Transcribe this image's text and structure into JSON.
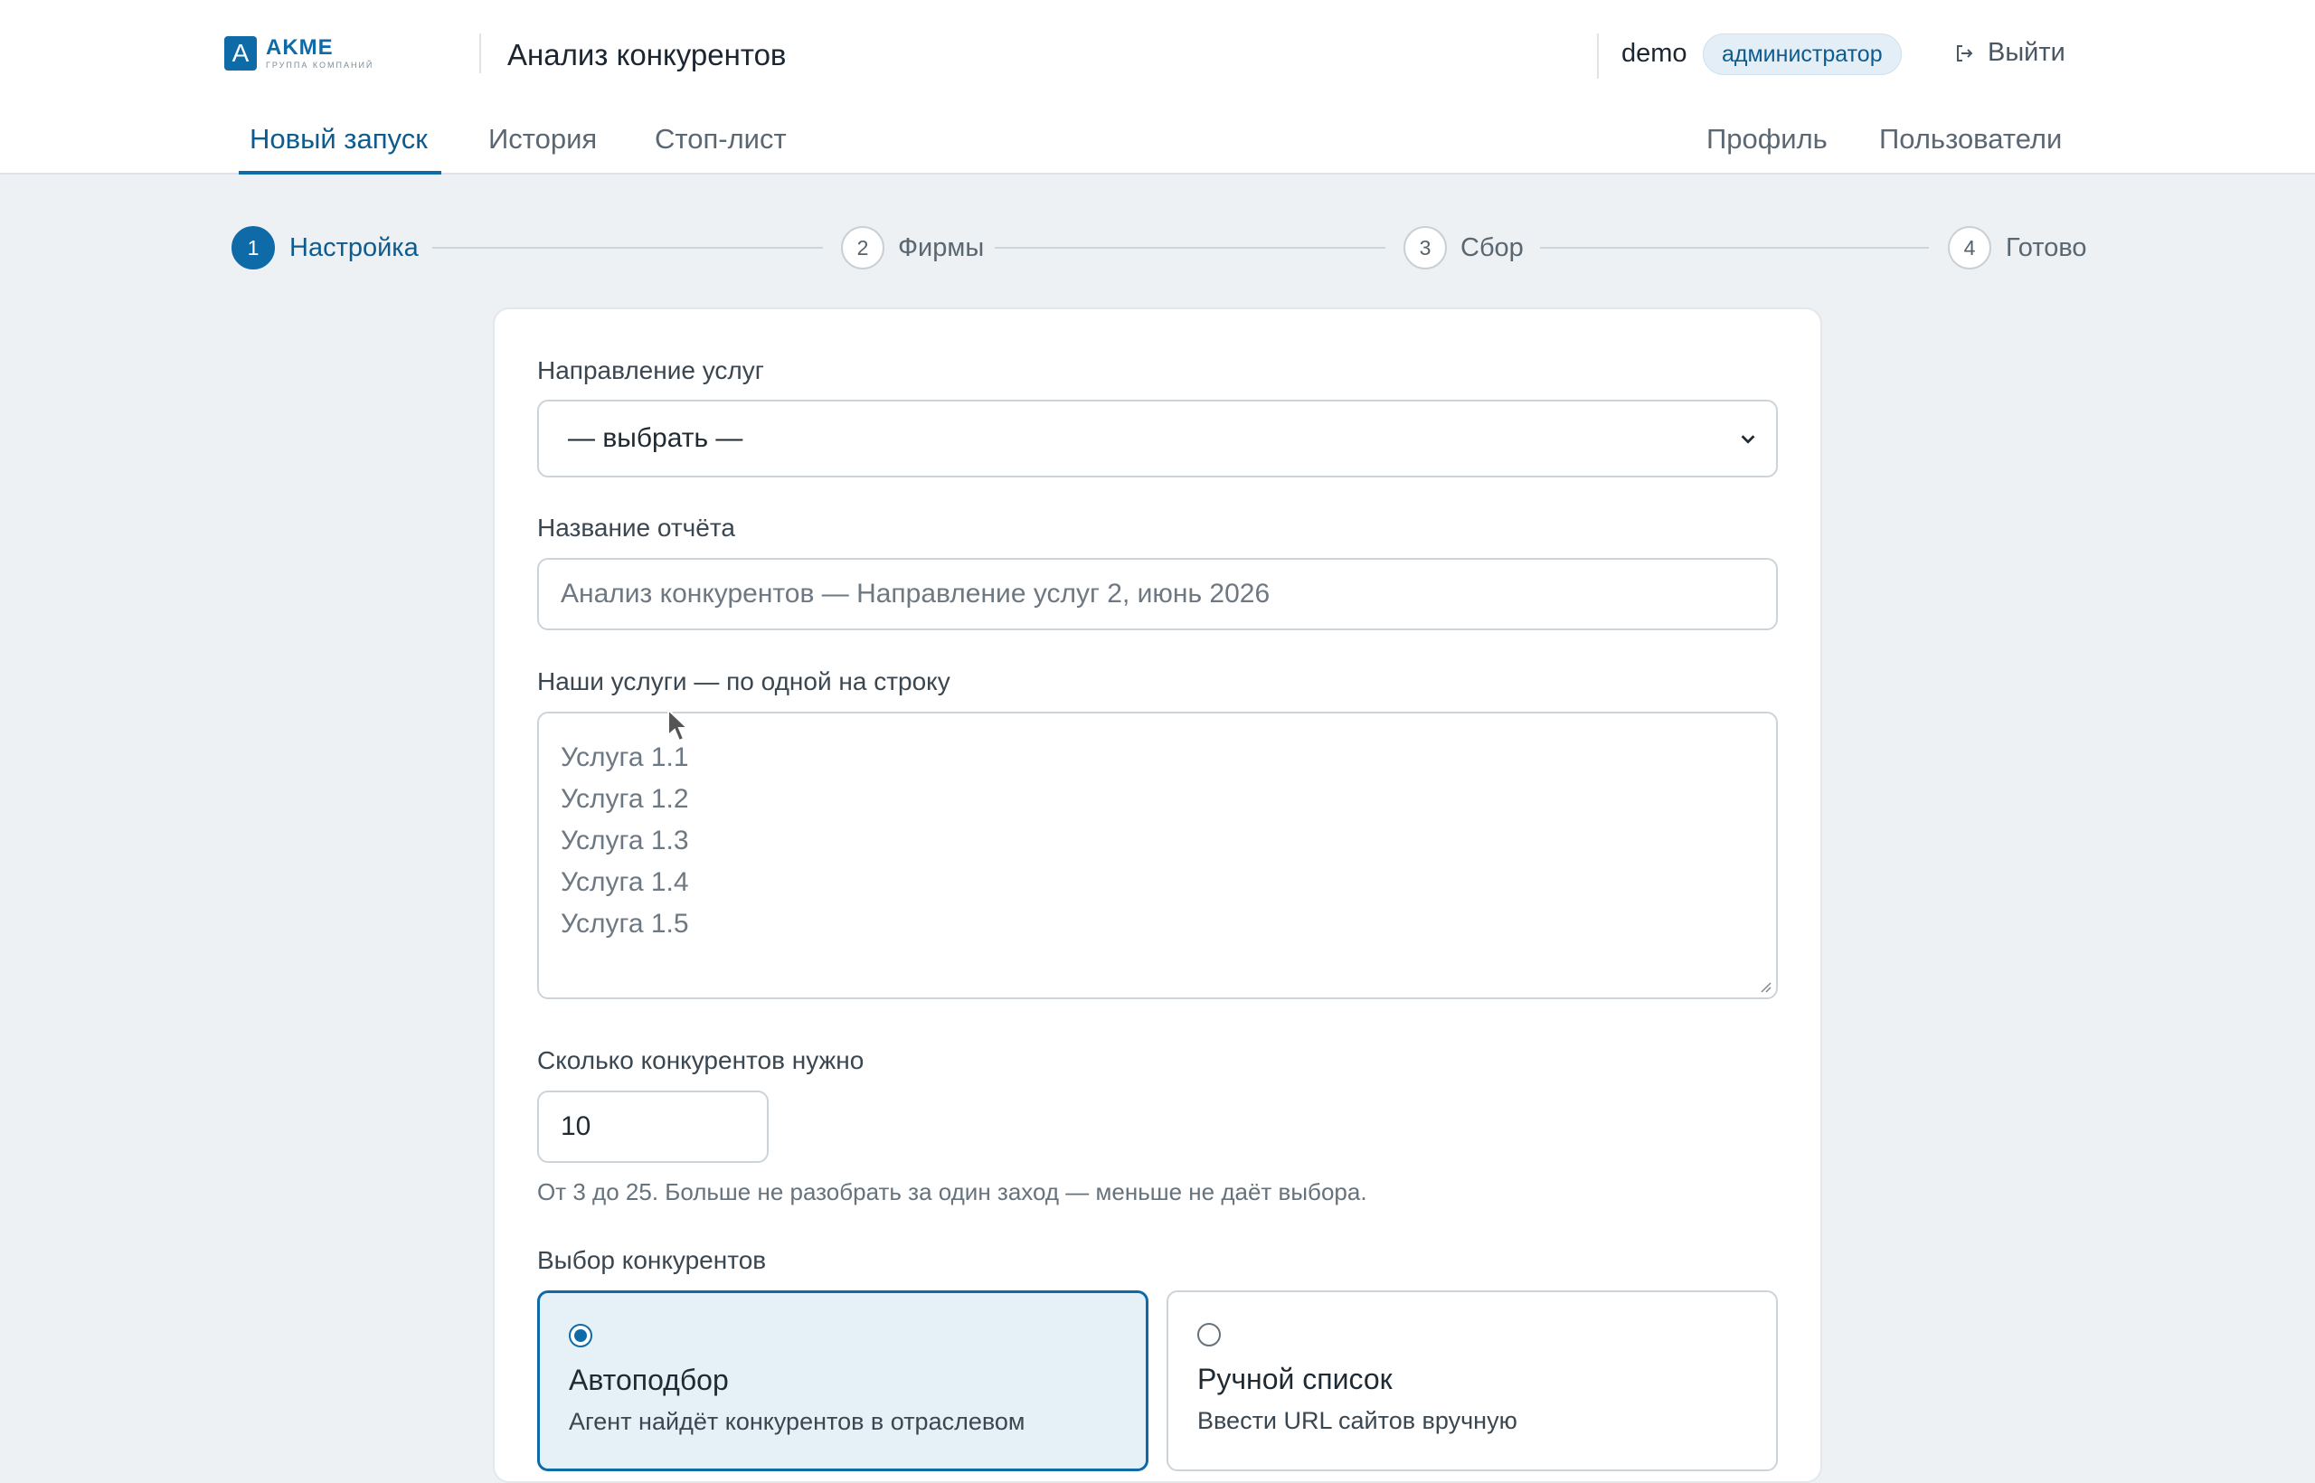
{
  "colors": {
    "accent": "#0e6ba8",
    "background": "#eef1f4",
    "corner_mark": "#ff00ee"
  },
  "header": {
    "logo": {
      "name": "AKME",
      "subtitle": "ГРУППА КОМПАНИЙ",
      "mark": "A"
    },
    "app_title": "Анализ конкурентов",
    "user": {
      "name": "demo",
      "role": "администратор"
    },
    "logout_label": "Выйти",
    "logout_icon": "logout-icon"
  },
  "nav": {
    "tabs": [
      {
        "label": "Новый запуск",
        "active": true
      },
      {
        "label": "История",
        "active": false
      },
      {
        "label": "Стоп-лист",
        "active": false
      }
    ],
    "right_links": [
      {
        "label": "Профиль"
      },
      {
        "label": "Пользователи"
      }
    ]
  },
  "stepper": {
    "steps": [
      {
        "number": "1",
        "label": "Настройка",
        "active": true
      },
      {
        "number": "2",
        "label": "Фирмы",
        "active": false
      },
      {
        "number": "3",
        "label": "Сбор",
        "active": false
      },
      {
        "number": "4",
        "label": "Готово",
        "active": false
      }
    ]
  },
  "form": {
    "direction": {
      "label": "Направление услуг",
      "value": "— выбрать —",
      "icon": "chevron-down-icon"
    },
    "report_name": {
      "label": "Название отчёта",
      "placeholder": "Анализ конкурентов — Направление услуг 2, июнь 2026"
    },
    "services": {
      "label": "Наши услуги — по одной на строку",
      "placeholder_lines": [
        "Услуга 1.1",
        "Услуга 1.2",
        "Услуга 1.3",
        "Услуга 1.4",
        "Услуга 1.5"
      ]
    },
    "competitor_count": {
      "label": "Сколько конкурентов нужно",
      "value": "10",
      "hint": "От 3 до 25. Больше не разобрать за один заход — меньше не даёт выбора."
    },
    "selection": {
      "label": "Выбор конкурентов",
      "options": [
        {
          "title": "Автоподбор",
          "description": "Агент найдёт конкурентов в отраслевом",
          "selected": true
        },
        {
          "title": "Ручной список",
          "description": "Ввести URL сайтов вручную",
          "selected": false
        }
      ]
    }
  }
}
